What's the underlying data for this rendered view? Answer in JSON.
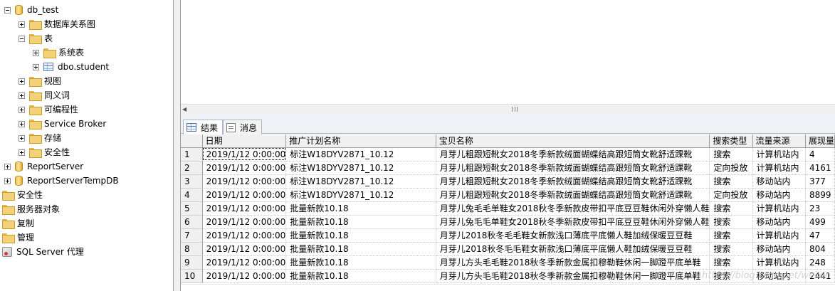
{
  "tree": {
    "items": [
      {
        "label": "db_test",
        "level": 1,
        "icon": "database-icon",
        "expander": "minus"
      },
      {
        "label": "数据库关系图",
        "level": 2,
        "icon": "folder-icon",
        "expander": "plus"
      },
      {
        "label": "表",
        "level": 2,
        "icon": "folder-icon",
        "expander": "minus"
      },
      {
        "label": "系统表",
        "level": 3,
        "icon": "folder-icon",
        "expander": "plus"
      },
      {
        "label": "dbo.student",
        "level": 3,
        "icon": "table-icon",
        "expander": "plus"
      },
      {
        "label": "视图",
        "level": 2,
        "icon": "folder-icon",
        "expander": "plus"
      },
      {
        "label": "同义词",
        "level": 2,
        "icon": "folder-icon",
        "expander": "plus"
      },
      {
        "label": "可编程性",
        "level": 2,
        "icon": "folder-icon",
        "expander": "plus"
      },
      {
        "label": "Service Broker",
        "level": 2,
        "icon": "folder-icon",
        "expander": "plus"
      },
      {
        "label": "存储",
        "level": 2,
        "icon": "folder-icon",
        "expander": "plus"
      },
      {
        "label": "安全性",
        "level": 2,
        "icon": "folder-icon",
        "expander": "plus"
      },
      {
        "label": "ReportServer",
        "level": 1,
        "icon": "database-icon",
        "expander": "plus"
      },
      {
        "label": "ReportServerTempDB",
        "level": 1,
        "icon": "database-icon",
        "expander": "plus"
      },
      {
        "label": "安全性",
        "level": 0,
        "icon": "folder-icon",
        "expander": "none"
      },
      {
        "label": "服务器对象",
        "level": 0,
        "icon": "folder-icon",
        "expander": "none"
      },
      {
        "label": "复制",
        "level": 0,
        "icon": "folder-icon",
        "expander": "none"
      },
      {
        "label": "管理",
        "level": 0,
        "icon": "folder-icon",
        "expander": "none"
      },
      {
        "label": "SQL Server 代理",
        "level": 0,
        "icon": "sql-agent-icon",
        "expander": "none"
      }
    ]
  },
  "tabs": {
    "results": "结果",
    "messages": "消息"
  },
  "grid": {
    "columns": [
      "日期",
      "推广计划名称",
      "宝贝名称",
      "搜索类型",
      "流量来源",
      "展现量"
    ],
    "rows": [
      [
        "1",
        "2019/1/12 0:00:00",
        "标注W18DYV2871_10.12",
        "月芽儿粗跟短靴女2018冬季新款绒面蝴蝶结高跟短筒女靴舒适踝靴",
        "搜索",
        "计算机站内",
        "4"
      ],
      [
        "2",
        "2019/1/12 0:00:00",
        "标注W18DYV2871_10.12",
        "月芽儿粗跟短靴女2018冬季新款绒面蝴蝶结高跟短筒女靴舒适踝靴",
        "定向投放",
        "计算机站内",
        "4161"
      ],
      [
        "3",
        "2019/1/12 0:00:00",
        "标注W18DYV2871_10.12",
        "月芽儿粗跟短靴女2018冬季新款绒面蝴蝶结高跟短筒女靴舒适踝靴",
        "搜索",
        "移动站内",
        "377"
      ],
      [
        "4",
        "2019/1/12 0:00:00",
        "标注W18DYV2871_10.12",
        "月芽儿粗跟短靴女2018冬季新款绒面蝴蝶结高跟短筒女靴舒适踝靴",
        "定向投放",
        "移动站内",
        "8899"
      ],
      [
        "5",
        "2019/1/12 0:00:00",
        "批量新款10.18",
        "月芽儿兔毛毛单鞋女2018秋冬季新款皮带扣平底豆豆鞋休闲外穿懒人鞋",
        "搜索",
        "计算机站内",
        "23"
      ],
      [
        "6",
        "2019/1/12 0:00:00",
        "批量新款10.18",
        "月芽儿兔毛毛单鞋女2018秋冬季新款皮带扣平底豆豆鞋休闲外穿懒人鞋",
        "搜索",
        "移动站内",
        "499"
      ],
      [
        "7",
        "2019/1/12 0:00:00",
        "批量新款10.18",
        "月芽儿2018秋冬毛毛鞋女新款浅口薄底平底懒人鞋加绒保暖豆豆鞋",
        "搜索",
        "计算机站内",
        "47"
      ],
      [
        "8",
        "2019/1/12 0:00:00",
        "批量新款10.18",
        "月芽儿2018秋冬毛毛鞋女新款浅口薄底平底懒人鞋加绒保暖豆豆鞋",
        "搜索",
        "移动站内",
        "804"
      ],
      [
        "9",
        "2019/1/12 0:00:00",
        "批量新款10.18",
        "月芽儿方头毛毛鞋2018秋冬季新款金属扣穆勒鞋休闲一脚蹬平底单鞋",
        "搜索",
        "计算机站内",
        "248"
      ],
      [
        "10",
        "2019/1/12 0:00:00",
        "批量新款10.18",
        "月芽儿方头毛毛鞋2018秋冬季新款金属扣穆勒鞋休闲一脚蹬平底单鞋",
        "搜索",
        "移动站内",
        "2441"
      ]
    ]
  },
  "watermark": "https://blog.csdn.net/weixin"
}
